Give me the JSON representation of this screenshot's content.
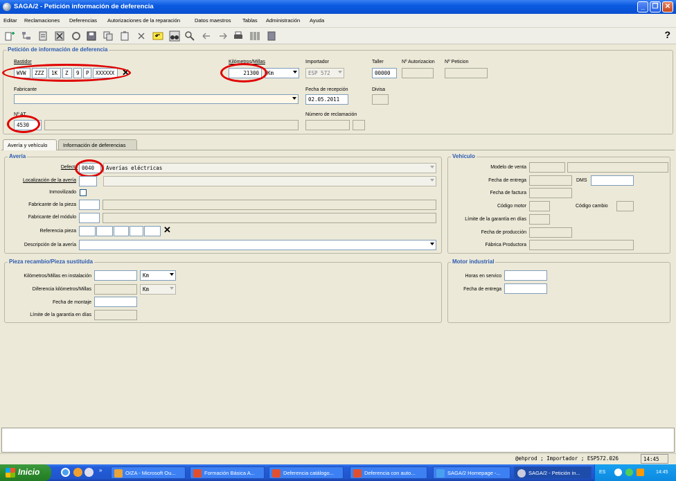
{
  "window": {
    "title": "SAGA/2 - Petición información de deferencia"
  },
  "menu": [
    "Editar",
    "Reclamaciones",
    "Deferencias",
    "Autorizaciones de la reparación",
    "Datos maestros",
    "Tablas",
    "Administración",
    "Ayuda"
  ],
  "toolbar": {
    "help": "?"
  },
  "header": {
    "group_title": "Petición de información de deferencia",
    "bastidor_label": "Bastidor",
    "bastidor": [
      "WVW",
      "ZZZ",
      "1K",
      "Z",
      "9",
      "P",
      "XXXXXX"
    ],
    "km_label": "Kilómetros/Millas",
    "km_value": "21300",
    "km_unit": "Km",
    "importador_label": "Importador",
    "importador_value": "ESP 572",
    "taller_label": "Taller",
    "taller_value": "00000",
    "autorizacion_label": "Nº Autorizacion",
    "peticion_label": "Nº Peticion",
    "fabricante_label": "Fabricante",
    "fecha_recepcion_label": "Fecha de recepción",
    "fecha_recepcion_value": "02.05.2011",
    "divisa_label": "Divisa",
    "nat_label": "Nº AT",
    "nat_value": "4530",
    "reclamacion_label": "Número de reclamación"
  },
  "tabs": [
    "Avería y vehículo",
    "Información de deferencias"
  ],
  "averia": {
    "title": "Avería",
    "defecto_label": "Defecto",
    "defecto_code": "0040",
    "defecto_desc": "Averías eléctricas",
    "localizacion_label": "Localización de la avería",
    "inmovilizado_label": "Inmovilizado",
    "fab_pieza_label": "Fabricante de la pieza",
    "fab_modulo_label": "Fabricante del módulo",
    "referencia_label": "Referencia pieza",
    "descripcion_label": "Descripción de la avería"
  },
  "vehiculo": {
    "title": "Vehículo",
    "modelo_label": "Modelo de venta",
    "fecha_entrega_label": "Fecha de entrega",
    "dms_label": "DMS",
    "fecha_factura_label": "Fecha de factura",
    "codigo_motor_label": "Código motor",
    "codigo_cambio_label": "Código cambio",
    "limite_label": "Límite de la garantía en días",
    "fecha_produccion_label": "Fecha de producción",
    "fabrica_label": "Fábrica Productora"
  },
  "pieza": {
    "title": "Pieza recambio/Pieza sustituida",
    "km_instalacion_label": "Kilómetros/Millas en instalación",
    "km_unit1": "Km",
    "diferencia_label": "Diferencia kilómetros/Millas",
    "km_unit2": "Km",
    "fecha_montaje_label": "Fecha de montaje",
    "limite_label": "Límite de la garantía en días"
  },
  "motor": {
    "title": "Motor industrial",
    "horas_label": "Horas en servico",
    "fecha_entrega_label": "Fecha de entrega"
  },
  "status": {
    "text": "@ehprod ; Importador ; ESP572.026",
    "time": "14:45"
  },
  "taskbar": {
    "start": "Inicio",
    "tasks": [
      "OIZA - Microsoft Ou...",
      "Formación Básica A...",
      "Deferencia catálogo...",
      "Deferencia con auto...",
      "SAGA/2 Homepage -...",
      "SAGA/2 - Petición in..."
    ],
    "lang": "ES",
    "clock": "14:45"
  }
}
